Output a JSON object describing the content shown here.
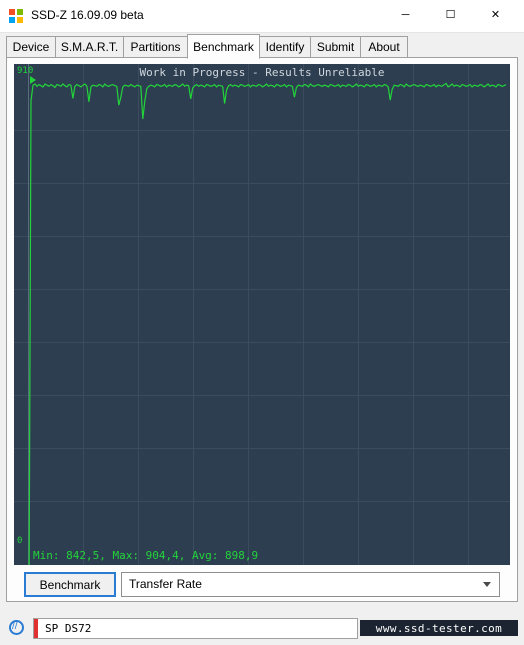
{
  "window": {
    "title": "SSD-Z 16.09.09 beta",
    "icon": "windows-logo-icon",
    "buttons": {
      "minimize": "─",
      "maximize": "☐",
      "close": "✕"
    }
  },
  "tabs": [
    {
      "label": "Device",
      "active": false
    },
    {
      "label": "S.M.A.R.T.",
      "active": false
    },
    {
      "label": "Partitions",
      "active": false
    },
    {
      "label": "Benchmark",
      "active": true
    },
    {
      "label": "Identify",
      "active": false
    },
    {
      "label": "Submit",
      "active": false
    },
    {
      "label": "About",
      "active": false
    }
  ],
  "graph": {
    "title": "Work in Progress - Results Unreliable",
    "y_top_label": "910",
    "y_bottom_label": "0",
    "stats_line": "Min: 842,5, Max: 904,4, Avg: 898,9",
    "line_color": "#22d43a",
    "background_color": "#2d3e50",
    "grid_color": "#3c4c5e"
  },
  "chart_data": {
    "type": "line",
    "title": "Work in Progress - Results Unreliable",
    "xlabel": "",
    "ylabel": "",
    "ylim": [
      0,
      910
    ],
    "grid": true,
    "legend": null,
    "series": [
      {
        "name": "Transfer Rate",
        "values": [
          0,
          874,
          901,
          903,
          899,
          902,
          900,
          898,
          903,
          901,
          899,
          902,
          900,
          897,
          902,
          901,
          899,
          903,
          900,
          898,
          902,
          901,
          878,
          899,
          902,
          900,
          898,
          901,
          903,
          899,
          872,
          898,
          901,
          900,
          899,
          902,
          901,
          898,
          903,
          900,
          899,
          901,
          902,
          900,
          899,
          866,
          880,
          898,
          901,
          900,
          899,
          902,
          900,
          898,
          901,
          900,
          899,
          842,
          873,
          895,
          899,
          901,
          900,
          898,
          902,
          901,
          899,
          900,
          902,
          898,
          901,
          900,
          899,
          902,
          901,
          898,
          900,
          903,
          899,
          901,
          900,
          877,
          896,
          900,
          902,
          899,
          901,
          900,
          898,
          902,
          901,
          899,
          900,
          902,
          898,
          901,
          900,
          899,
          869,
          893,
          900,
          902,
          899,
          901,
          900,
          898,
          902,
          901,
          899,
          900,
          902,
          898,
          901,
          900,
          899,
          902,
          901,
          898,
          900,
          903,
          899,
          901,
          900,
          898,
          902,
          901,
          899,
          900,
          902,
          898,
          901,
          900,
          899,
          880,
          897,
          901,
          900,
          899,
          902,
          901,
          898,
          903,
          900,
          899,
          901,
          902,
          900,
          899,
          901,
          900,
          898,
          902,
          901,
          899,
          900,
          902,
          898,
          901,
          900,
          899,
          902,
          901,
          898,
          900,
          903,
          899,
          901,
          900,
          898,
          902,
          901,
          899,
          900,
          902,
          898,
          901,
          900,
          899,
          902,
          901,
          898,
          875,
          894,
          901,
          900,
          899,
          902,
          901,
          898,
          903,
          900,
          899,
          901,
          902,
          900,
          899,
          901,
          900,
          898,
          902,
          901,
          899,
          900,
          902,
          898,
          901,
          900,
          899,
          902,
          904,
          898,
          900,
          903,
          899,
          901,
          900,
          898,
          902,
          901,
          899,
          900,
          902,
          898,
          901,
          900,
          899,
          902,
          901,
          898,
          900,
          903,
          899,
          901,
          900,
          898,
          902,
          901,
          899,
          900,
          902
        ]
      }
    ]
  },
  "controls": {
    "benchmark_button": "Benchmark",
    "mode_select": {
      "value": "Transfer Rate",
      "options": [
        "Transfer Rate"
      ]
    }
  },
  "statusbar": {
    "icon": "drive-scan-icon",
    "device": "SP  DS72",
    "watermark": "www.ssd-tester.com"
  }
}
